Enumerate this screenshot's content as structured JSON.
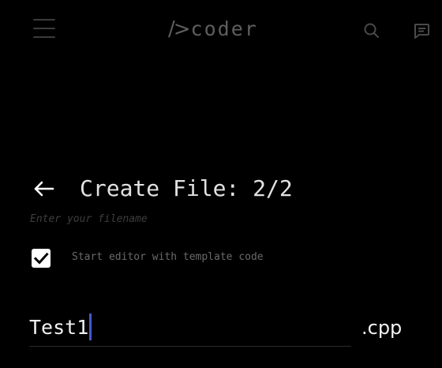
{
  "app_bar": {
    "logo_mark": "/>",
    "logo_text": "coder",
    "menu_icon": "hamburger-menu-icon",
    "search_icon": "search-icon",
    "chat_icon": "chat-bubble-icon"
  },
  "header": {
    "back_icon": "arrow-left-icon",
    "title": "Create File: 2/2",
    "hint": "Enter your filename"
  },
  "options": {
    "template_checkbox": {
      "checked": true,
      "label": "Start editor with template code"
    }
  },
  "filename": {
    "value": "Test1",
    "extension": ".cpp"
  },
  "colors": {
    "background": "#000000",
    "caret": "#4658c8",
    "checkbox_fill": "#ffffff"
  }
}
